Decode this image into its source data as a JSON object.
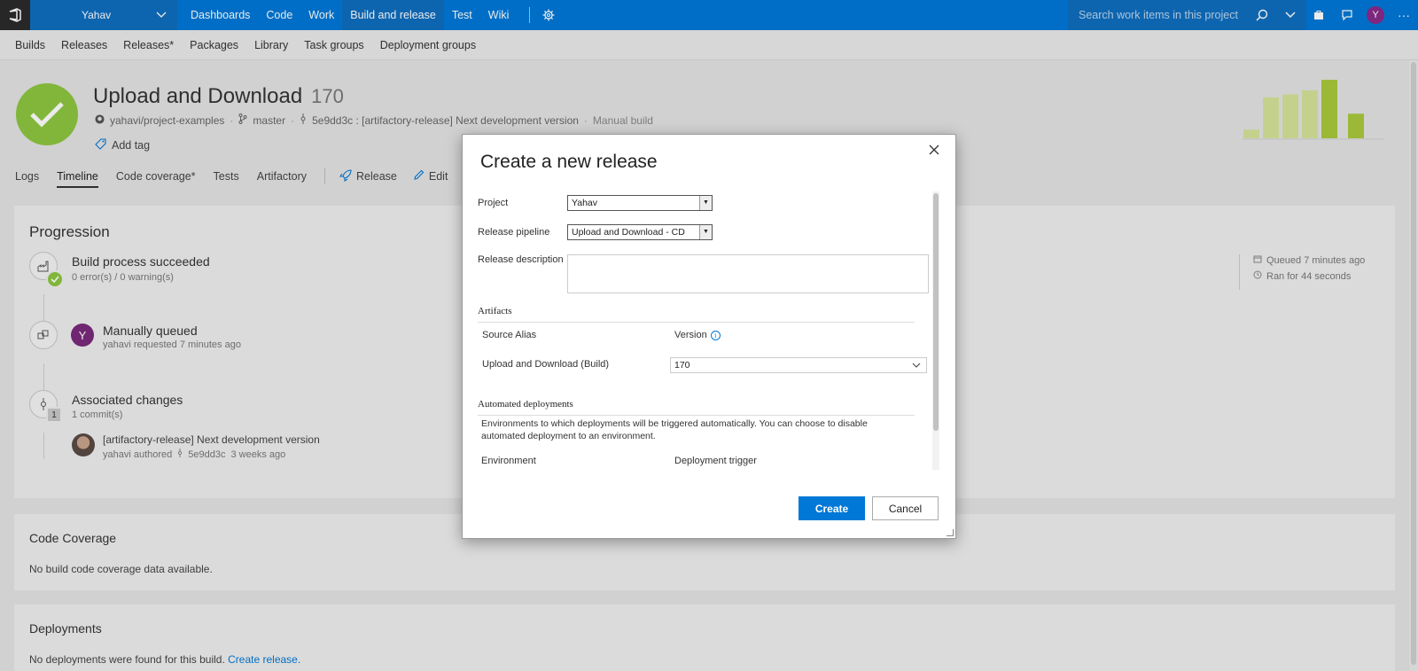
{
  "topbar": {
    "project": "Yahav",
    "nav": [
      "Dashboards",
      "Code",
      "Work",
      "Build and release",
      "Test",
      "Wiki"
    ],
    "active_nav": "Build and release",
    "search_placeholder": "Search work items in this project",
    "avatar_initial": "Y",
    "accent": "#0078d7"
  },
  "subnav": [
    "Builds",
    "Releases",
    "Releases*",
    "Packages",
    "Library",
    "Task groups",
    "Deployment groups"
  ],
  "build": {
    "title": "Upload and Download",
    "number": "170",
    "repo": "yahavi/project-examples",
    "branch": "master",
    "commit": "5e9dd3c : [artifactory-release] Next development version",
    "trigger": "Manual build",
    "add_tag": "Add tag",
    "status_color": "#8dc63f"
  },
  "history_chart": {
    "values": [
      0.15,
      0.7,
      0.75,
      0.82,
      1.0,
      0.42
    ],
    "current_color": "#a9c93c",
    "past_color": "#d4e39a"
  },
  "tabs": [
    "Logs",
    "Timeline",
    "Code coverage*",
    "Tests",
    "Artifactory"
  ],
  "active_tab": "Timeline",
  "actions": {
    "release": "Release",
    "edit": "Edit"
  },
  "progression": {
    "title": "Progression",
    "steps": [
      {
        "title": "Build process succeeded",
        "sub": "0 error(s) / 0 warning(s)"
      },
      {
        "title": "Manually queued",
        "sub": "yahavi requested 7 minutes ago",
        "avatar": "Y"
      },
      {
        "title": "Associated changes",
        "sub": "1 commit(s)",
        "badge": "1"
      }
    ],
    "commit": {
      "message": "[artifactory-release] Next development version",
      "author": "yahavi authored",
      "hash": "5e9dd3c",
      "when": "3 weeks ago"
    },
    "queued": "Queued 7 minutes ago",
    "ran": "Ran for 44 seconds"
  },
  "code_coverage": {
    "title": "Code Coverage",
    "text": "No build code coverage data available."
  },
  "deployments": {
    "title": "Deployments",
    "text": "No deployments were found for this build.",
    "link": "Create release."
  },
  "modal": {
    "title": "Create a new release",
    "project_label": "Project",
    "project_value": "Yahav",
    "pipeline_label": "Release pipeline",
    "pipeline_value": "Upload and Download - CD",
    "description_label": "Release description",
    "artifacts_title": "Artifacts",
    "source_alias_header": "Source Alias",
    "version_header": "Version",
    "artifact_name": "Upload and Download (Build)",
    "artifact_version": "170",
    "auto_title": "Automated deployments",
    "auto_desc": "Environments to which deployments will be triggered automatically. You can choose to disable automated deployment to an environment.",
    "env_header": "Environment",
    "trigger_header": "Deployment trigger",
    "create": "Create",
    "cancel": "Cancel"
  }
}
